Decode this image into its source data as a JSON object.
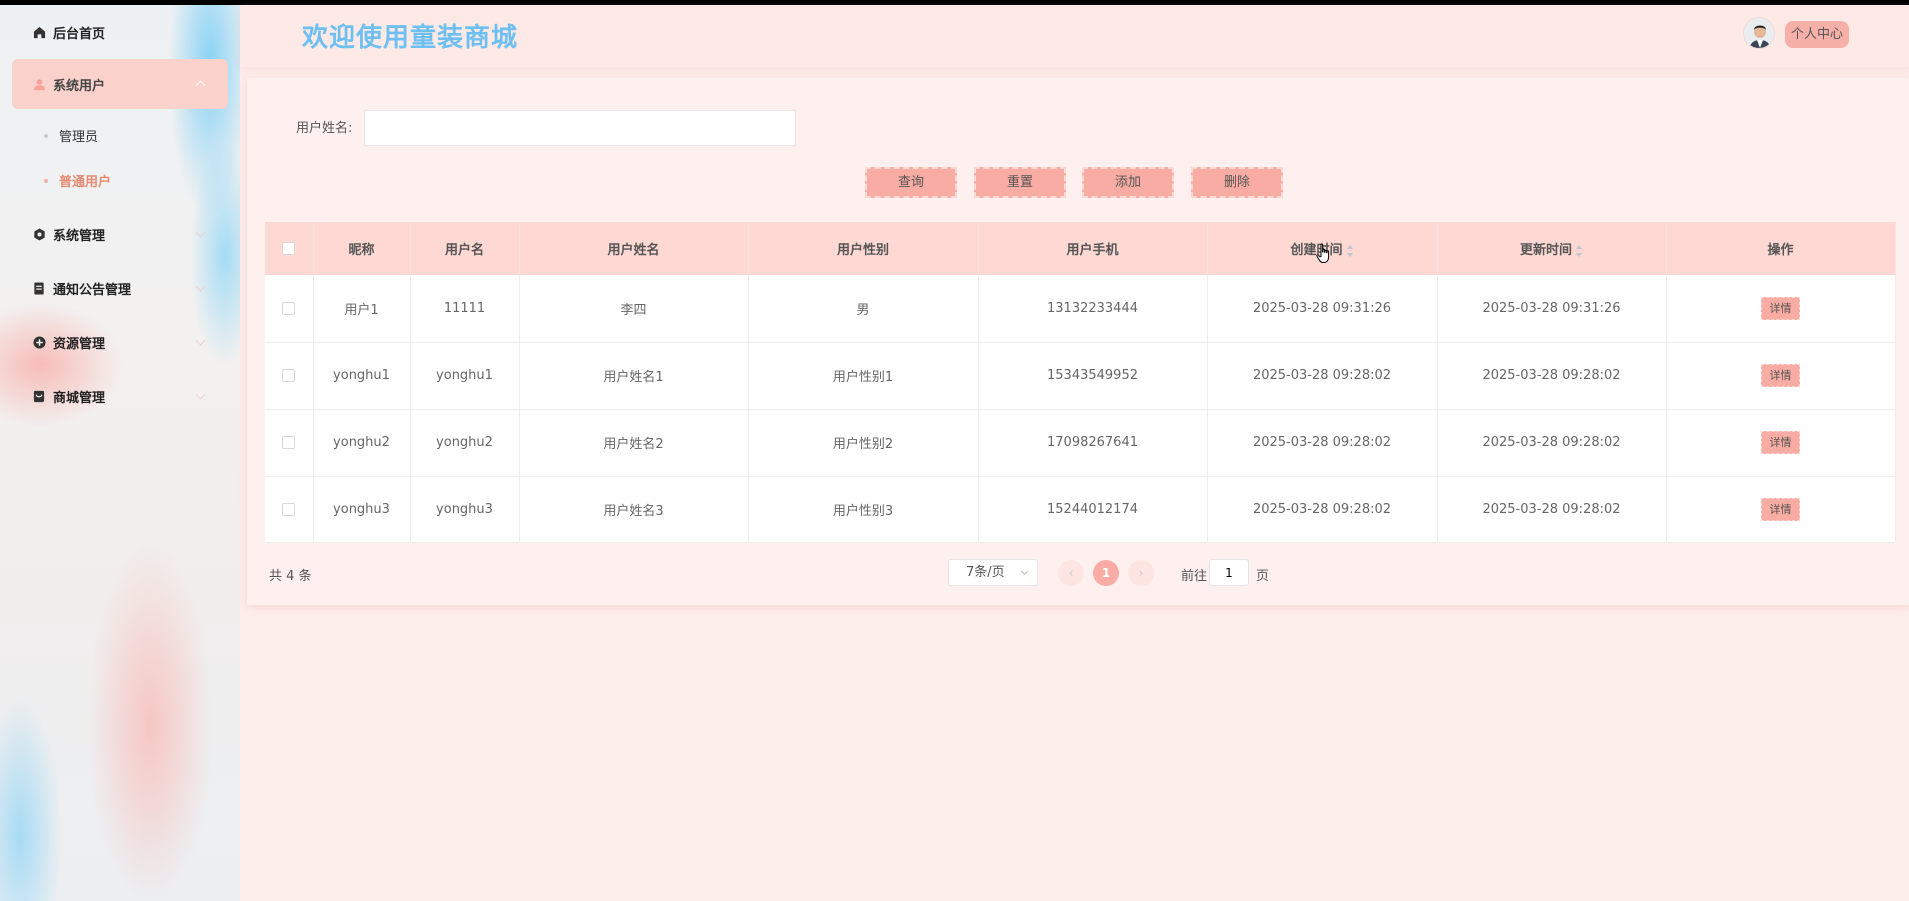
{
  "sidebar": {
    "items": [
      {
        "label": "后台首页",
        "icon": "home-icon"
      },
      {
        "label": "系统用户",
        "icon": "user-icon",
        "expanded": true,
        "children": [
          {
            "label": "管理员"
          },
          {
            "label": "普通用户",
            "current": true
          }
        ]
      },
      {
        "label": "系统管理",
        "icon": "gear-icon"
      },
      {
        "label": "通知公告管理",
        "icon": "notice-icon"
      },
      {
        "label": "资源管理",
        "icon": "plus-circle-icon"
      },
      {
        "label": "商城管理",
        "icon": "shop-icon"
      }
    ]
  },
  "header": {
    "title": "欢迎使用童装商城",
    "profile_label": "个人中心"
  },
  "search": {
    "label": "用户姓名:",
    "value": "",
    "placeholder": ""
  },
  "actions": {
    "query": "查询",
    "reset": "重置",
    "add": "添加",
    "delete": "删除"
  },
  "table": {
    "columns": [
      "昵称",
      "用户名",
      "用户姓名",
      "用户性别",
      "用户手机",
      "创建时间",
      "更新时间",
      "操作"
    ],
    "rows": [
      {
        "nickname": "用户1",
        "username": "11111",
        "realname": "李四",
        "gender": "男",
        "phone": "13132233444",
        "created": "2025-03-28 09:31:26",
        "updated": "2025-03-28 09:31:26",
        "action": "详情"
      },
      {
        "nickname": "yonghu1",
        "username": "yonghu1",
        "realname": "用户姓名1",
        "gender": "用户性别1",
        "phone": "15343549952",
        "created": "2025-03-28 09:28:02",
        "updated": "2025-03-28 09:28:02",
        "action": "详情"
      },
      {
        "nickname": "yonghu2",
        "username": "yonghu2",
        "realname": "用户姓名2",
        "gender": "用户性别2",
        "phone": "17098267641",
        "created": "2025-03-28 09:28:02",
        "updated": "2025-03-28 09:28:02",
        "action": "详情"
      },
      {
        "nickname": "yonghu3",
        "username": "yonghu3",
        "realname": "用户姓名3",
        "gender": "用户性别3",
        "phone": "15244012174",
        "created": "2025-03-28 09:28:02",
        "updated": "2025-03-28 09:28:02",
        "action": "详情"
      }
    ]
  },
  "pagination": {
    "total": "共 4 条",
    "page_size": "7条/页",
    "current_page": "1",
    "goto_label": "前往",
    "goto_value": "1",
    "goto_suffix": "页"
  },
  "colors": {
    "accent": "#f9aca3",
    "title": "#6fc0f2",
    "header_row": "#fed8d3",
    "background": "#fdedeb",
    "active_text": "#e58b73"
  }
}
